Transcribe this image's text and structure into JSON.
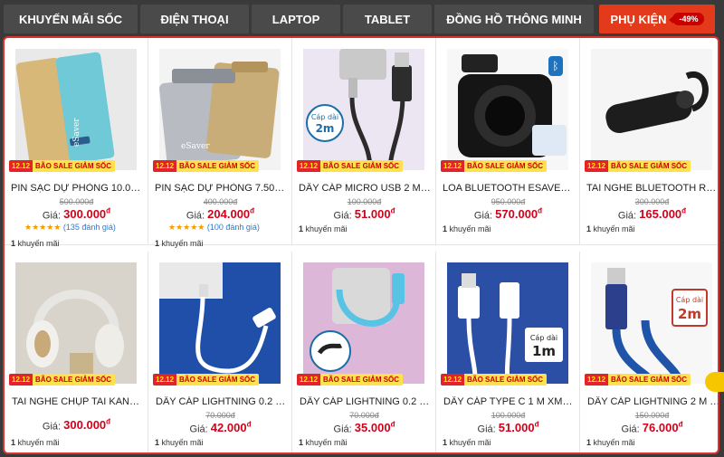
{
  "tabs": [
    {
      "label": "KHUYẾN MÃI SỐC"
    },
    {
      "label": "ĐIỆN THOẠI"
    },
    {
      "label": "LAPTOP"
    },
    {
      "label": "TABLET"
    },
    {
      "label": "ĐỒNG HỒ THÔNG MINH"
    },
    {
      "label": "PHỤ KIỆN",
      "discount": "-49%"
    }
  ],
  "badge": {
    "date": "12.12",
    "text": "BÃO SALE GIẢM SỐC"
  },
  "price_label": "Giá:",
  "currency": "đ",
  "promo_count": "1",
  "promo_label": "khuyến mãi",
  "products": [
    {
      "name": "PIN SẠC DỰ PHÒNG 10.000...",
      "old": "500.000đ",
      "price": "300.000",
      "stars": "★★★★★",
      "reviews": "(135 đánh giá)"
    },
    {
      "name": "PIN SẠC DỰ PHÒNG 7.500 ...",
      "old": "400.000đ",
      "price": "204.000",
      "stars": "★★★★★",
      "reviews": "(100 đánh giá)"
    },
    {
      "name": "DÂY CÁP MICRO USB 2 M X...",
      "old": "100.000đ",
      "price": "51.000"
    },
    {
      "name": "LOA BLUETOOTH ESAVER ...",
      "old": "950.000đ",
      "price": "570.000"
    },
    {
      "name": "TAI NGHE BLUETOOTH RO...",
      "old": "300.000đ",
      "price": "165.000"
    },
    {
      "name": "TAI NGHE CHỤP TAI KANEN...",
      "old": "",
      "price": "300.000"
    },
    {
      "name": "DÂY CÁP LIGHTNING 0.2 M ...",
      "old": "70.000đ",
      "price": "42.000"
    },
    {
      "name": "DÂY CÁP LIGHTNING 0.2 M ...",
      "old": "70.000đ",
      "price": "35.000"
    },
    {
      "name": "DÂY CÁP TYPE C 1 M XMO...",
      "old": "100.000đ",
      "price": "51.000"
    },
    {
      "name": "DÂY CÁP LIGHTNING 2 M E...",
      "old": "150.000đ",
      "price": "76.000"
    }
  ],
  "image_captions": {
    "cable_2m": "Cáp dài 2m",
    "cable_1m": "Cáp dài 1m",
    "cable_2m_b": "Cáp dài 2m"
  },
  "colors": {
    "accent": "#e23a1a",
    "price": "#d0021b",
    "badge_bg": "#ffe14d"
  }
}
